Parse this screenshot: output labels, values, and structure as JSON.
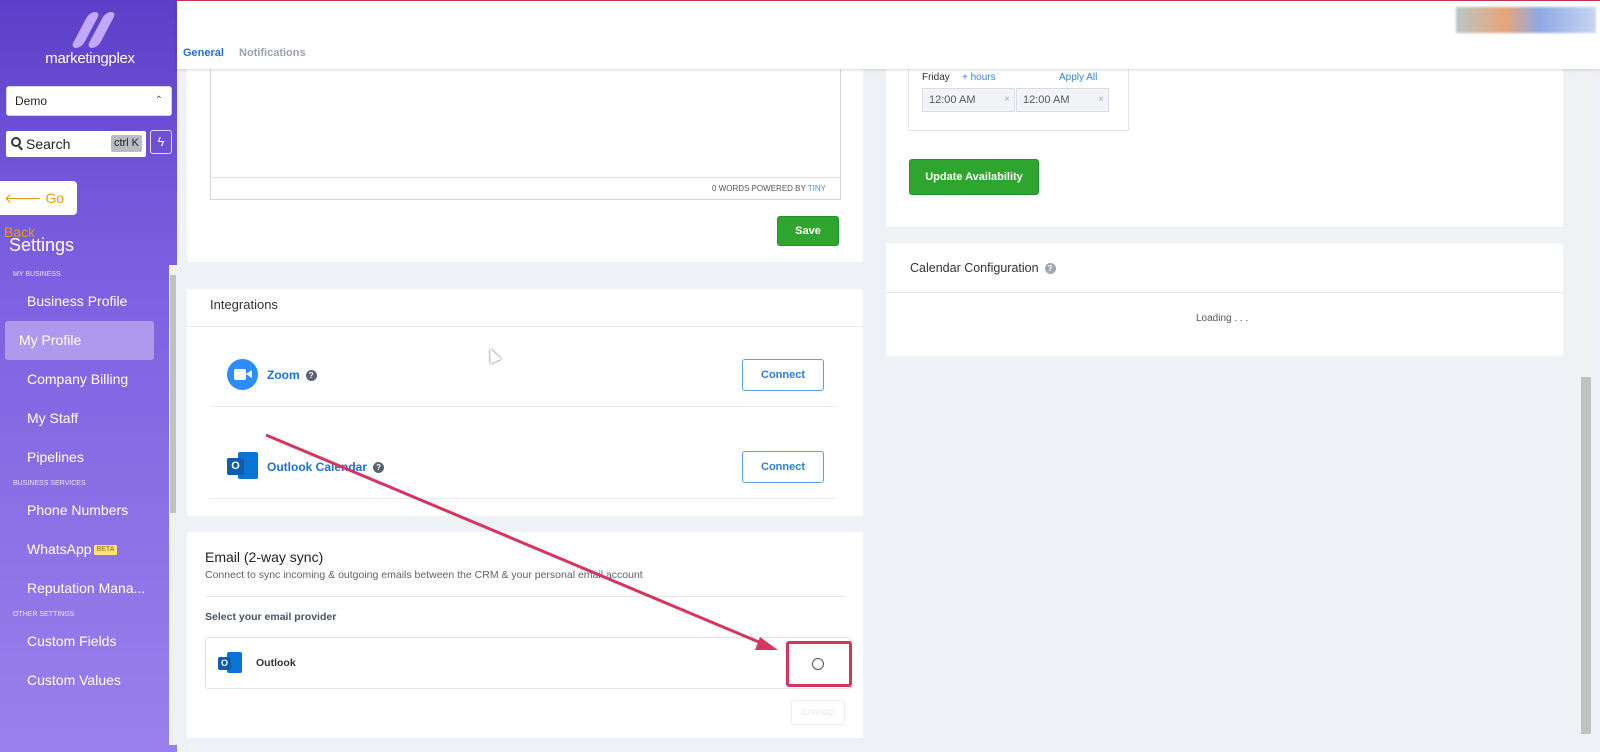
{
  "sidebar": {
    "logo_text": "marketingplex",
    "location": "Demo",
    "search_label": "Search",
    "search_shortcut": "ctrl K",
    "go_back": "Go Back",
    "settings_title": "Settings",
    "sections": [
      {
        "label": "MY BUSINESS",
        "items": [
          "Business Profile",
          "My Profile",
          "Company Billing",
          "My Staff",
          "Pipelines"
        ]
      },
      {
        "label": "BUSINESS SERVICES",
        "items": [
          "Phone Numbers",
          "WhatsApp",
          "Reputation Mana..."
        ]
      },
      {
        "label": "OTHER SETTINGS",
        "items": [
          "Custom Fields",
          "Custom Values"
        ]
      }
    ],
    "active_item": "My Profile",
    "beta_badge": "BETA"
  },
  "tabs": {
    "general": "General",
    "notifications": "Notifications"
  },
  "editor": {
    "footer_words": "0 WORDS POWERED BY",
    "footer_brand": "TINY"
  },
  "save_label": "Save",
  "integrations": {
    "title": "Integrations",
    "items": [
      {
        "name": "Zoom",
        "action": "Connect"
      },
      {
        "name": "Outlook Calendar",
        "action": "Connect"
      }
    ]
  },
  "email_sync": {
    "title": "Email (2-way sync)",
    "subtitle": "Connect to sync incoming & outgoing emails between the CRM & your personal email account",
    "select_label": "Select your email provider",
    "provider": "Outlook",
    "connect_label": "Connect"
  },
  "availability": {
    "day": "Friday",
    "add_hours": "+ hours",
    "apply_all": "Apply All",
    "start": "12:00 AM",
    "end": "12:00 AM",
    "update_label": "Update Availability"
  },
  "calendar_config": {
    "title": "Calendar Configuration",
    "loading": "Loading . . ."
  },
  "colors": {
    "accent": "#1e6fd9",
    "sidebar": "#7c5fe0",
    "success": "#2ea52e",
    "highlight": "#d4365f"
  },
  "icons": [
    "search-icon",
    "bolt-icon",
    "zoom-icon",
    "outlook-icon",
    "help-icon",
    "arrow-left-icon"
  ]
}
